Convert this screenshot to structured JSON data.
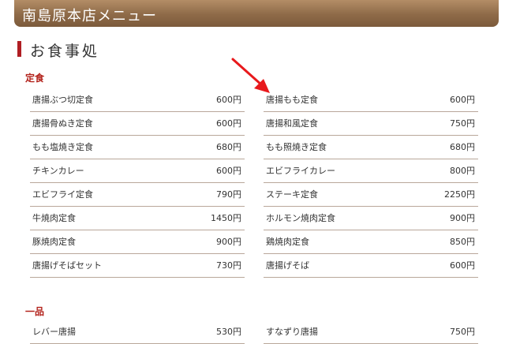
{
  "header": {
    "title": "南島原本店メニュー"
  },
  "section": {
    "title": "お食事処"
  },
  "teishoku": {
    "heading": "定食",
    "left": [
      {
        "name": "唐揚ぶつ切定食",
        "price": "600円"
      },
      {
        "name": "唐揚骨ぬき定食",
        "price": "600円"
      },
      {
        "name": "もも塩焼き定食",
        "price": "680円"
      },
      {
        "name": "チキンカレー",
        "price": "600円"
      },
      {
        "name": "エビフライ定食",
        "price": "790円"
      },
      {
        "name": "牛焼肉定食",
        "price": "1450円"
      },
      {
        "name": "豚焼肉定食",
        "price": "900円"
      },
      {
        "name": "唐揚げそばセット",
        "price": "730円"
      }
    ],
    "right": [
      {
        "name": "唐揚もも定食",
        "price": "600円"
      },
      {
        "name": "唐揚和風定食",
        "price": "750円"
      },
      {
        "name": "もも照焼き定食",
        "price": "680円"
      },
      {
        "name": "エビフライカレー",
        "price": "800円"
      },
      {
        "name": "ステーキ定食",
        "price": "2250円"
      },
      {
        "name": "ホルモン焼肉定食",
        "price": "900円"
      },
      {
        "name": "鶏焼肉定食",
        "price": "850円"
      },
      {
        "name": "唐揚げそば",
        "price": "600円"
      }
    ]
  },
  "ippin": {
    "heading": "一品",
    "left": [
      {
        "name": "レバー唐揚",
        "price": "530円"
      }
    ],
    "right": [
      {
        "name": "すなずり唐揚",
        "price": "750円"
      }
    ]
  },
  "colors": {
    "accent": "#b3231c",
    "banner": "#8e6a48",
    "arrow": "#e8191c"
  },
  "icons": {
    "pointer": "red-arrow-icon"
  }
}
